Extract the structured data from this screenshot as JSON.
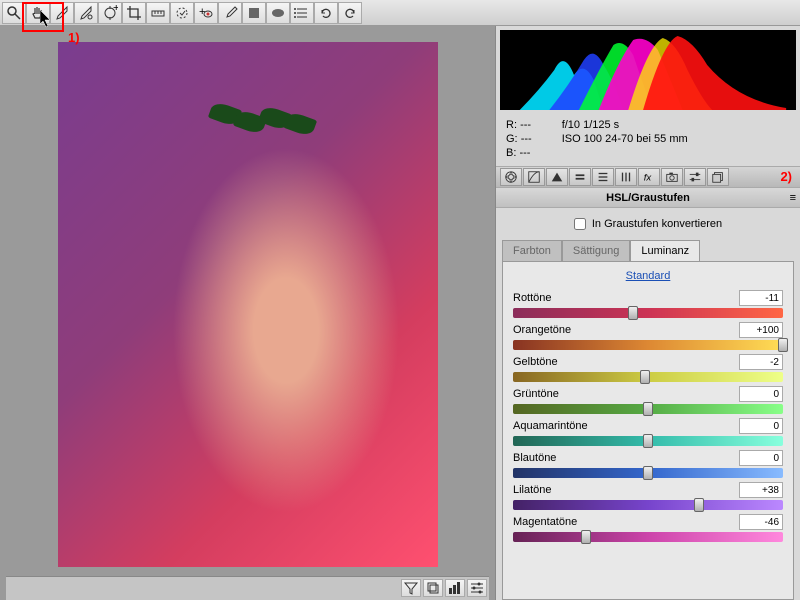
{
  "toolbar_icons": [
    "zoom",
    "hand",
    "eyedropper",
    "color-sampler",
    "target",
    "crop",
    "ruler",
    "heal",
    "redeye",
    "brush",
    "square",
    "oval",
    "list",
    "rotate-ccw",
    "rotate-cw"
  ],
  "annotations": {
    "one": "1)",
    "two": "2)"
  },
  "bottom_icons": [
    "funnel",
    "stack",
    "bars",
    "sliders"
  ],
  "rgb": {
    "r_label": "R:",
    "g_label": "G:",
    "b_label": "B:",
    "r": "---",
    "g": "---",
    "b": "---"
  },
  "exposure": {
    "line1": "f/10    1/125 s",
    "line2": "ISO 100    24-70 bei 55 mm"
  },
  "icon_row": [
    "aperture",
    "curves",
    "triangle",
    "equals",
    "bars2",
    "vert-bars",
    "fx",
    "camera",
    "sliders2",
    "stack2"
  ],
  "section_title": "HSL/Graustufen",
  "convert_label": "In Graustufen konvertieren",
  "tabs": [
    "Farbton",
    "Sättigung",
    "Luminanz"
  ],
  "active_tab": 2,
  "standard_link": "Standard",
  "sliders": [
    {
      "label": "Rottöne",
      "value": -11,
      "gradient": [
        "#8b2d5a",
        "#cc3355",
        "#ff6644"
      ]
    },
    {
      "label": "Orangetöne",
      "value": 100,
      "gradient": [
        "#883322",
        "#dd8833",
        "#ffdd55"
      ]
    },
    {
      "label": "Gelbtöne",
      "value": -2,
      "gradient": [
        "#886622",
        "#cccc44",
        "#eeff88"
      ]
    },
    {
      "label": "Grüntöne",
      "value": 0,
      "gradient": [
        "#556622",
        "#55aa44",
        "#88ff88"
      ]
    },
    {
      "label": "Aquamarintöne",
      "value": 0,
      "gradient": [
        "#226655",
        "#33bbaa",
        "#88ffdd"
      ]
    },
    {
      "label": "Blautöne",
      "value": 0,
      "gradient": [
        "#223366",
        "#3366cc",
        "#88bbff"
      ]
    },
    {
      "label": "Lilatöne",
      "value": 38,
      "gradient": [
        "#442266",
        "#7744cc",
        "#bb88ff"
      ]
    },
    {
      "label": "Magentatöne",
      "value": -46,
      "gradient": [
        "#662255",
        "#cc44aa",
        "#ff88dd"
      ]
    }
  ],
  "chart_data": {
    "type": "histogram",
    "channels": [
      "cyan",
      "blue",
      "green",
      "magenta",
      "yellow",
      "red"
    ],
    "note": "RGB/CMY histogram, peaks concentrated mid-to-high tones, long red tail to highlights"
  }
}
